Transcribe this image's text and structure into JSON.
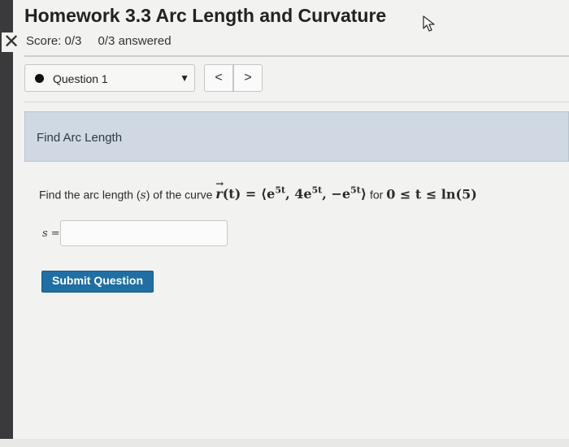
{
  "header": {
    "title": "Homework 3.3 Arc Length and Curvature",
    "close_glyph": "✕",
    "score_label": "Score: 0/3",
    "answered_label": "0/3 answered"
  },
  "question_nav": {
    "selected": "Question 1",
    "prev_glyph": "<",
    "next_glyph": ">"
  },
  "panel": {
    "title": "Find Arc Length"
  },
  "question": {
    "prefix": "Find the arc length (",
    "s_var": "s",
    "mid": ") of the curve ",
    "r_label": "r",
    "t_label": "(t) = ⟨e",
    "exp1": "5t",
    "comp2": ", 4e",
    "exp2": "5t",
    "comp3": ", −e",
    "exp3": "5t",
    "close": "⟩",
    "for_text": " for ",
    "range": "0 ≤ t ≤ ln(5)"
  },
  "answer": {
    "label": "s =",
    "value": ""
  },
  "submit_label": "Submit Question",
  "colors": {
    "submit_bg": "#1f6fa4",
    "panel_bg": "#cfd8e3"
  }
}
